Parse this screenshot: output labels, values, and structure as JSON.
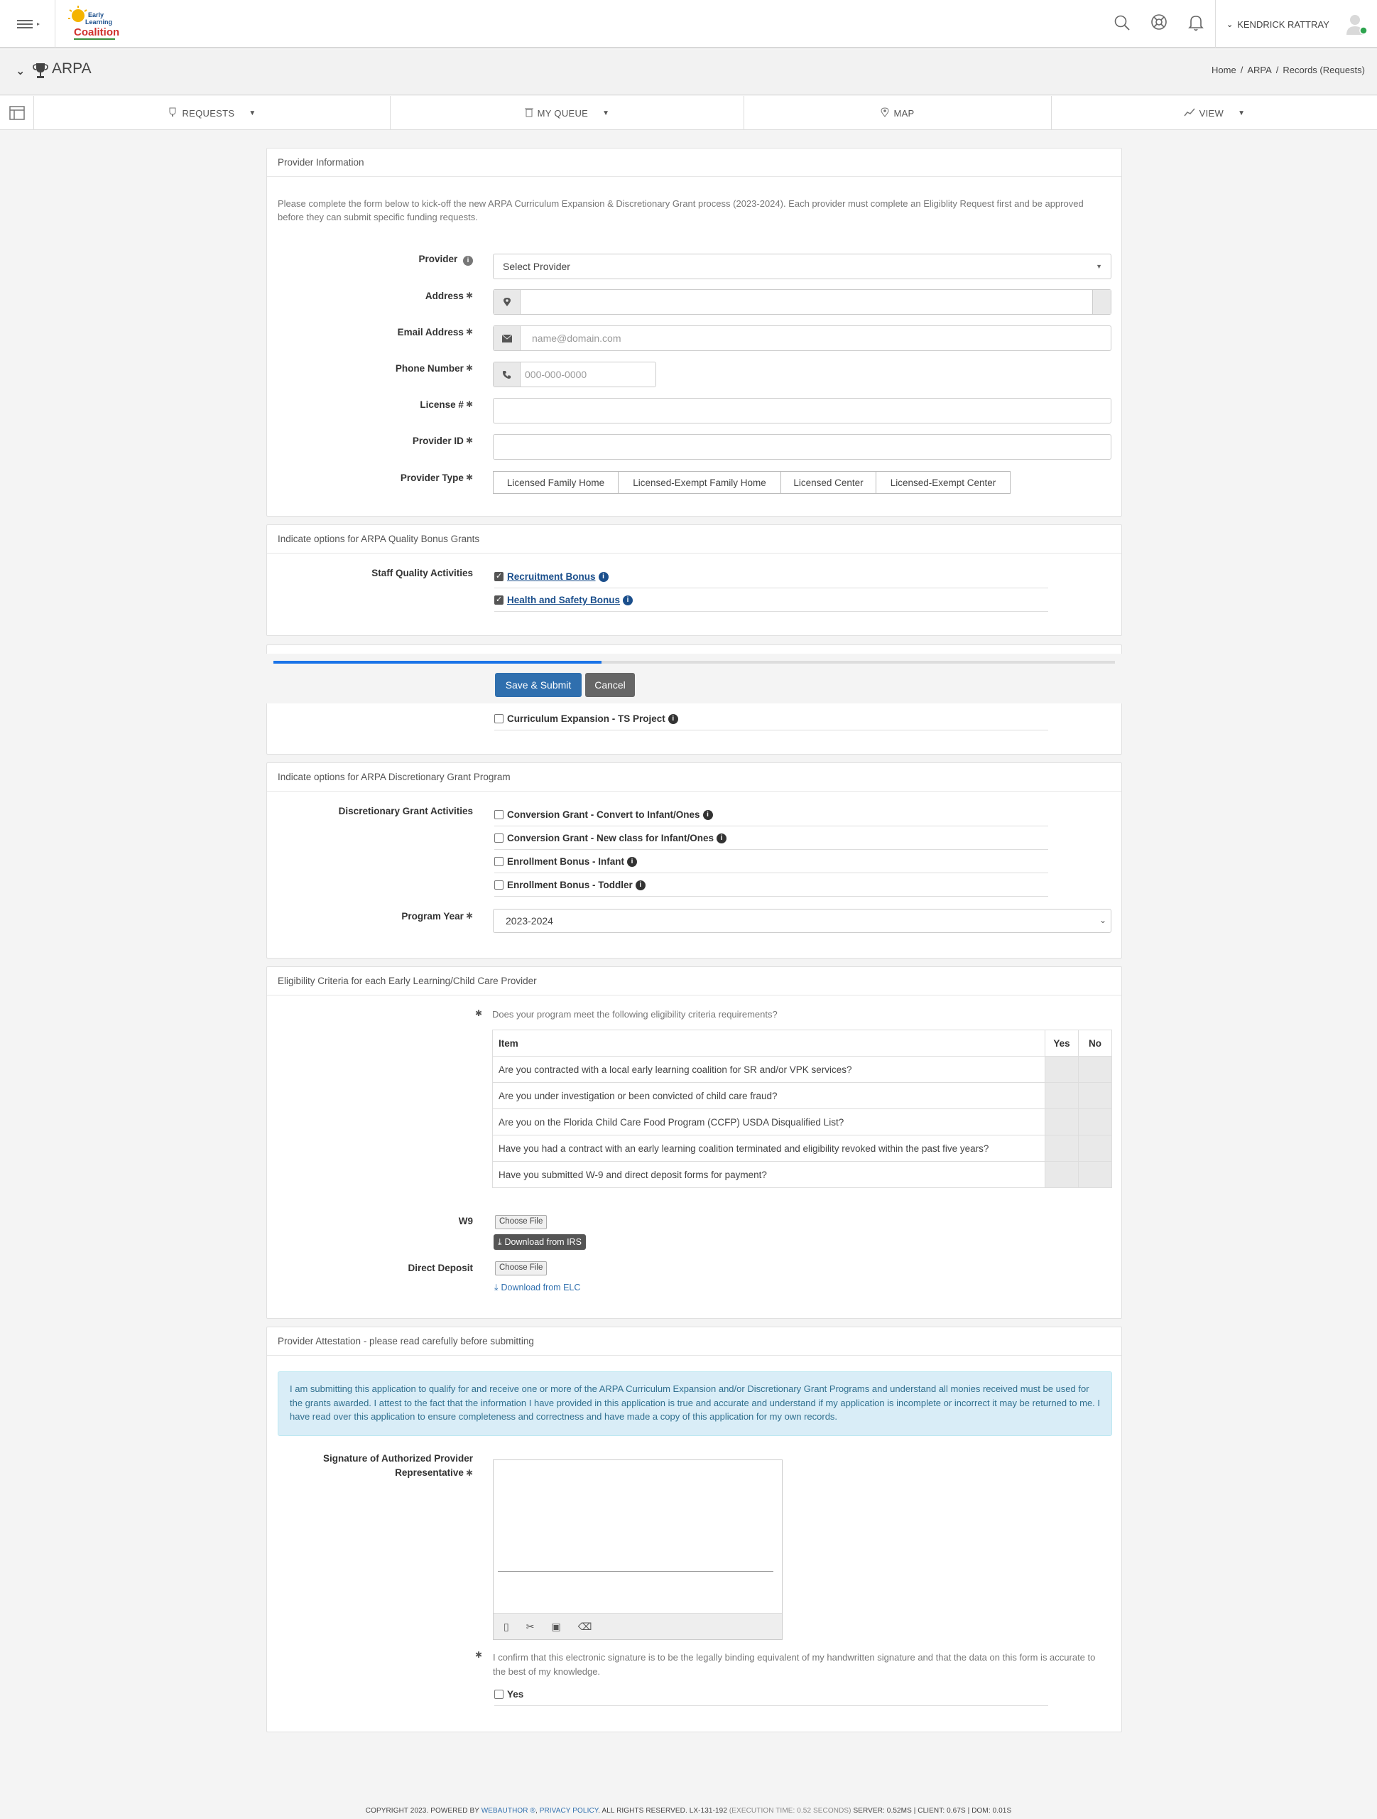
{
  "header": {
    "logo_text": "Early Learning Coalition",
    "username": "KENDRICK RATTRAY"
  },
  "subheader": {
    "title": "ARPA",
    "breadcrumb": [
      "Home",
      "/",
      "ARPA",
      "/",
      "Records (Requests)"
    ]
  },
  "nav": {
    "tabs": [
      {
        "label": "REQUESTS"
      },
      {
        "label": "MY QUEUE"
      },
      {
        "label": "MAP"
      },
      {
        "label": "VIEW"
      }
    ]
  },
  "provider_info": {
    "heading": "Provider Information",
    "intro": "Please complete the form below to kick-off the new ARPA Curriculum Expansion & Discretionary Grant process (2023-2024).  Each provider must complete an Eligiblity Request first and be approved before they can submit specific funding requests.",
    "provider_label": "Provider",
    "provider_value": "Select Provider",
    "address_label": "Address",
    "email_label": "Email Address",
    "email_placeholder": "name@domain.com",
    "phone_label": "Phone Number",
    "phone_placeholder": "000-000-0000",
    "license_label": "License #",
    "provider_id_label": "Provider ID",
    "provider_type_label": "Provider Type",
    "provider_types": [
      "Licensed Family Home",
      "Licensed-Exempt Family Home",
      "Licensed Center",
      "Licensed-Exempt Center"
    ]
  },
  "quality_bonus": {
    "heading": "Indicate options for ARPA Quality Bonus Grants",
    "label": "Staff Quality Activities",
    "options": [
      {
        "label": "Recruitment Bonus",
        "checked": true
      },
      {
        "label": "Health and Safety Bonus",
        "checked": true
      }
    ]
  },
  "actions": {
    "save_label": "Save & Submit",
    "cancel_label": "Cancel",
    "progress": 0.39
  },
  "curriculum": {
    "option": "Curriculum Expansion - TS Project"
  },
  "discretionary": {
    "heading": "Indicate options for ARPA Discretionary Grant Program",
    "label": "Discretionary Grant Activities",
    "options": [
      "Conversion Grant - Convert to Infant/Ones",
      "Conversion Grant - New class for Infant/Ones",
      "Enrollment Bonus - Infant",
      "Enrollment Bonus - Toddler"
    ],
    "program_year_label": "Program Year",
    "program_year_value": "2023-2024"
  },
  "eligibility": {
    "heading": "Eligibility Criteria for each Early Learning/Child Care Provider",
    "question": "Does your program meet the following eligibility criteria requirements?",
    "columns": [
      "Item",
      "Yes",
      "No"
    ],
    "rows": [
      "Are you contracted with a local early learning coalition for SR and/or VPK services?",
      "Are you under investigation or been convicted of child care fraud?",
      "Are you on the Florida Child Care Food Program (CCFP) USDA Disqualified List?",
      "Have you had a contract with an early learning coalition terminated and eligibility revoked within the past five years?",
      "Have you submitted W-9 and direct deposit forms for payment?"
    ],
    "w9_label": "W9",
    "choose_file": "Choose File",
    "download_irs": "Download from IRS",
    "direct_deposit_label": "Direct Deposit",
    "download_elc": "Download from ELC"
  },
  "attestation": {
    "heading": "Provider Attestation - please read carefully before submitting",
    "text": "I am submitting this application to qualify for and receive one or more of the ARPA Curriculum Expansion and/or Discretionary Grant Programs and understand all monies received must be used for the grants awarded. I attest to the fact that the information I have provided in this application is true and accurate and understand if my application is incomplete or incorrect it may be returned to me. I have read over this application to ensure completeness and correctness and have made a copy of this application for my own records.",
    "signature_label_1": "Signature of Authorized Provider",
    "signature_label_2": "Representative",
    "confirm_text": "I confirm that this electronic signature is to be the legally binding equivalent of my handwritten signature and that the data on this form is accurate to the best of my knowledge.",
    "yes_label": "Yes"
  },
  "footer": {
    "text_1": "COPYRIGHT 2023. POWERED BY ",
    "link_1": "WEBAUTHOR ®",
    "sep": ", ",
    "link_2": "PRIVACY POLICY",
    "text_2": ". ALL RIGHTS RESERVED. LX-131-192 ",
    "exec": "(EXECUTION TIME: 0.52 SECONDS)",
    "text_3": " SERVER: 0.52MS | CLIENT: 0.67S | DOM: 0.01S"
  },
  "colors": {
    "primary": "#2f6fae",
    "progress": "#1a73e8",
    "attestation_bg": "#d9edf7",
    "online": "#2ea44f"
  }
}
